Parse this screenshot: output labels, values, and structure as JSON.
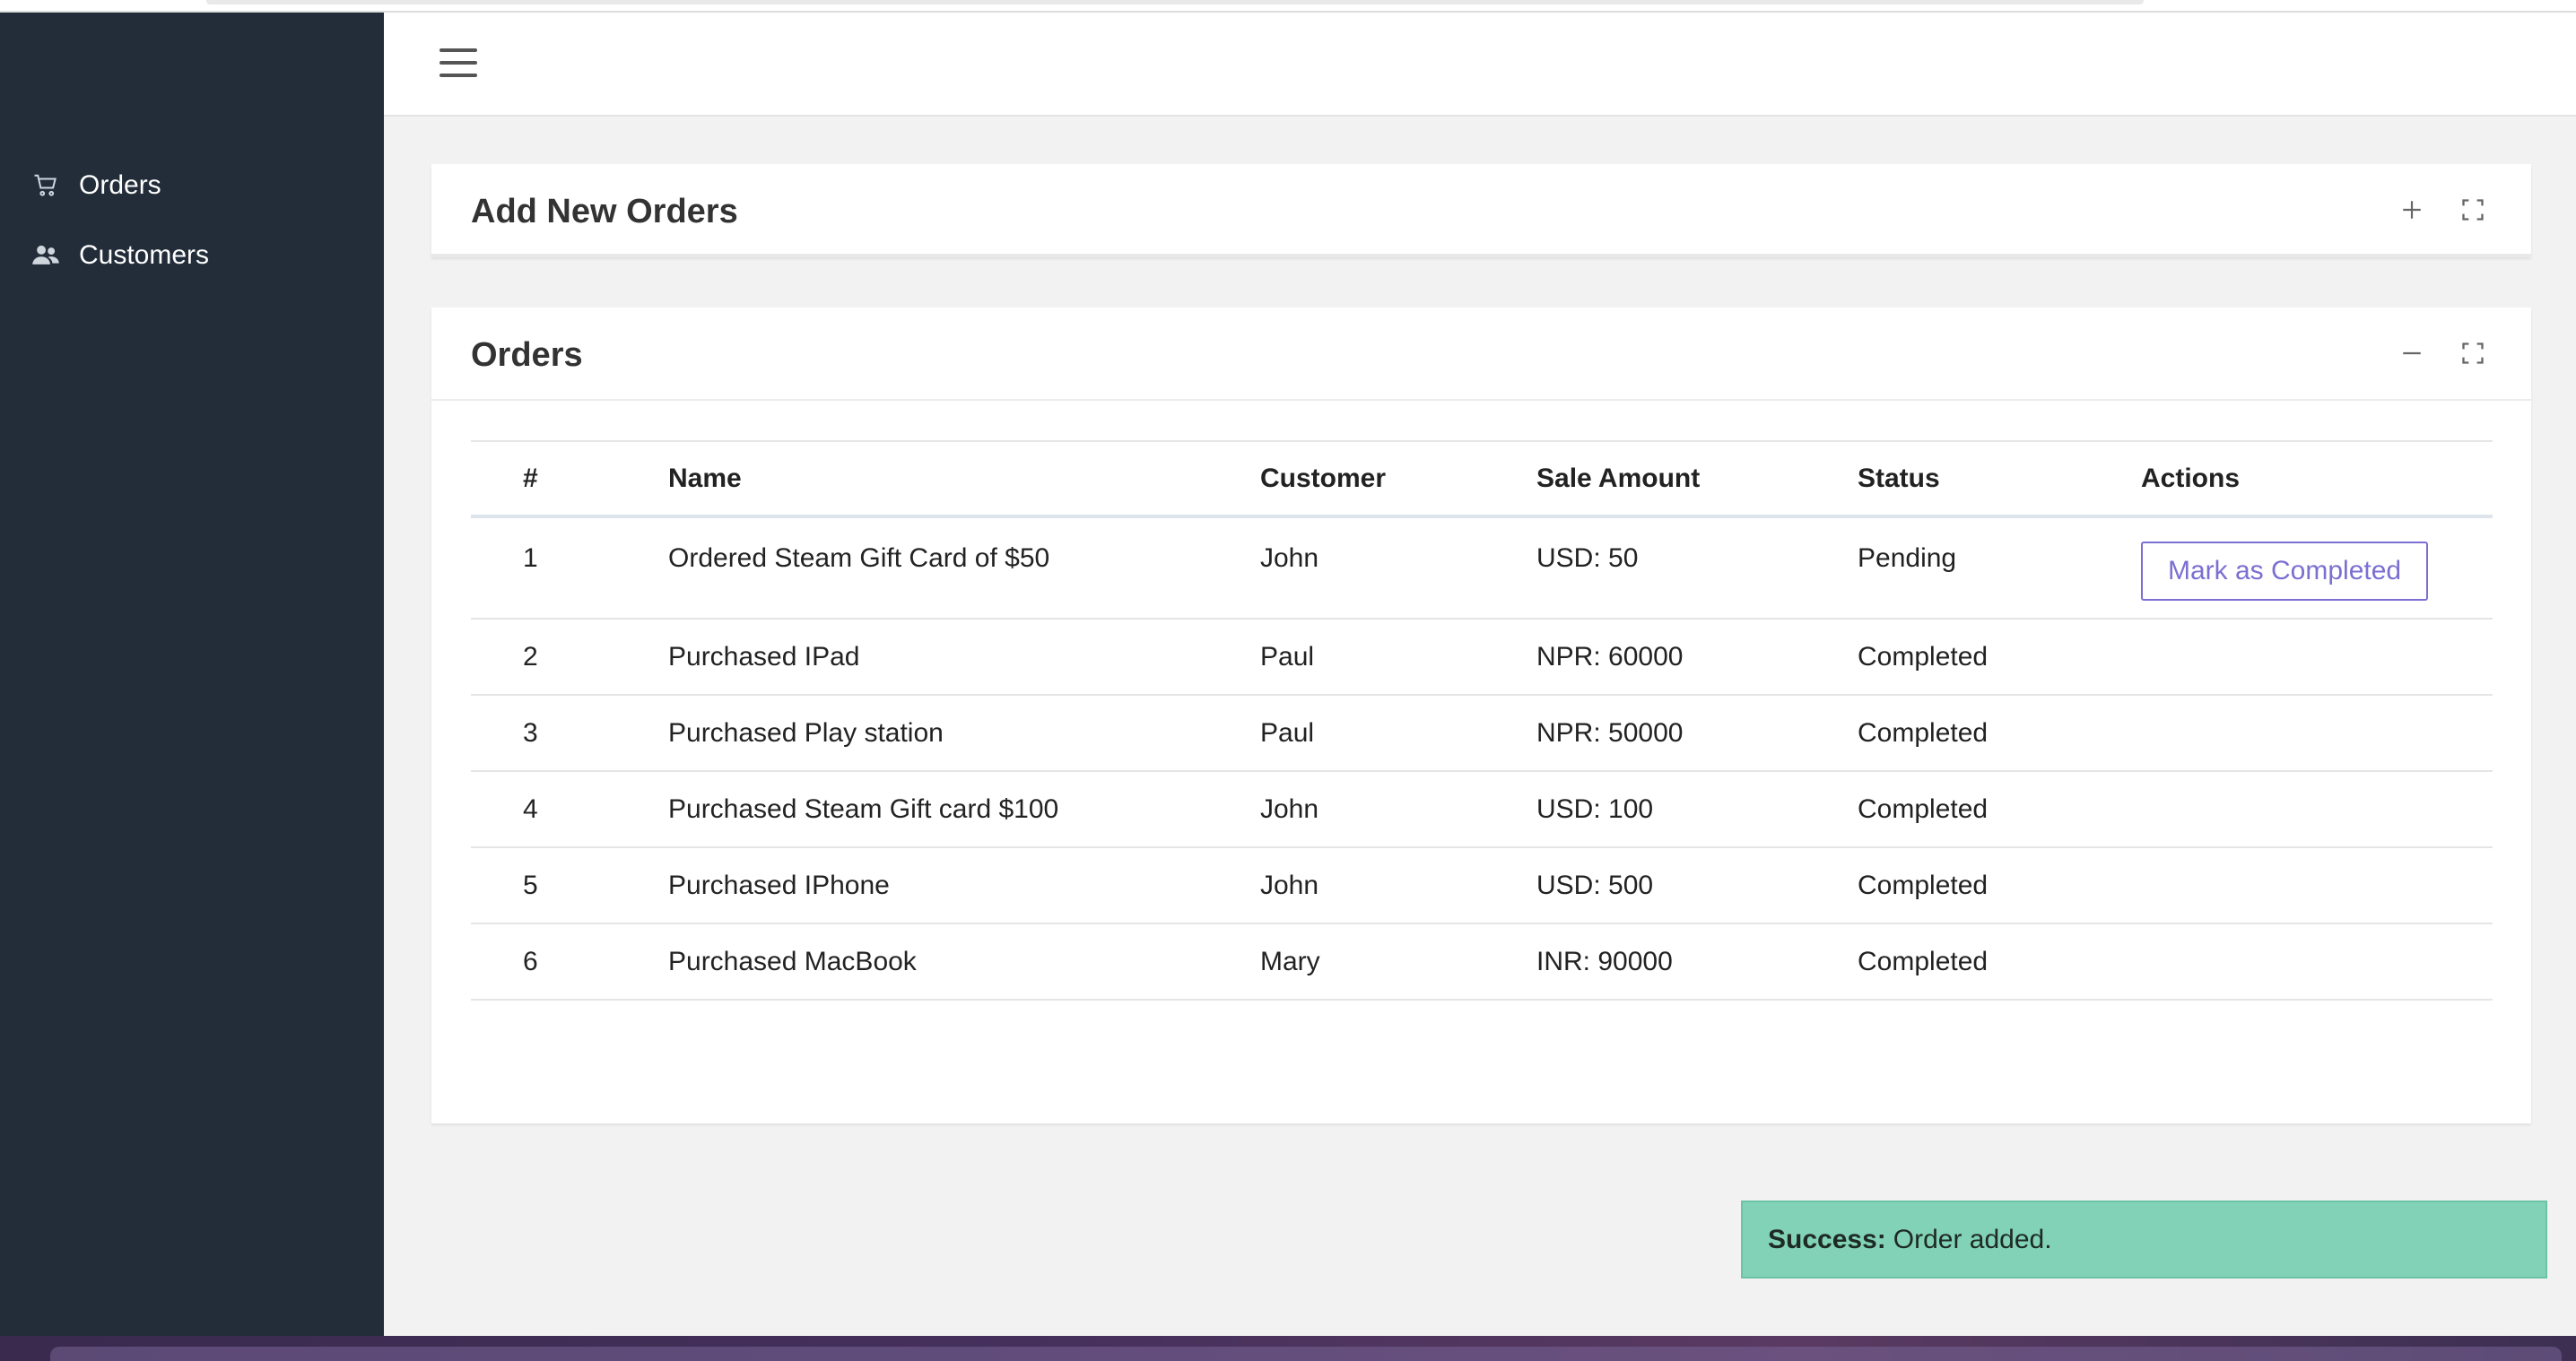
{
  "sidebar": {
    "items": [
      {
        "label": "Orders",
        "icon": "cart-icon"
      },
      {
        "label": "Customers",
        "icon": "users-icon"
      }
    ]
  },
  "header": {
    "menu_icon": "hamburger-icon"
  },
  "add_card": {
    "title": "Add New Orders"
  },
  "orders_card": {
    "title": "Orders",
    "columns": [
      "#",
      "Name",
      "Customer",
      "Sale Amount",
      "Status",
      "Actions"
    ],
    "rows": [
      {
        "num": "1",
        "name": "Ordered Steam Gift Card of $50",
        "customer": "John",
        "amount": "USD: 50",
        "status": "Pending",
        "action": "Mark as Completed"
      },
      {
        "num": "2",
        "name": "Purchased IPad",
        "customer": "Paul",
        "amount": "NPR: 60000",
        "status": "Completed",
        "action": ""
      },
      {
        "num": "3",
        "name": "Purchased Play station",
        "customer": "Paul",
        "amount": "NPR: 50000",
        "status": "Completed",
        "action": ""
      },
      {
        "num": "4",
        "name": "Purchased Steam Gift card $100",
        "customer": "John",
        "amount": "USD: 100",
        "status": "Completed",
        "action": ""
      },
      {
        "num": "5",
        "name": "Purchased IPhone",
        "customer": "John",
        "amount": "USD: 500",
        "status": "Completed",
        "action": ""
      },
      {
        "num": "6",
        "name": "Purchased MacBook",
        "customer": "Mary",
        "amount": "INR: 90000",
        "status": "Completed",
        "action": ""
      }
    ]
  },
  "toast": {
    "label": "Success:",
    "message": "Order added."
  },
  "colors": {
    "sidebar_bg": "#222d39",
    "accent": "#7b6fd1",
    "toast_bg": "#82d2b7",
    "page_bg": "#f2f2f2"
  }
}
